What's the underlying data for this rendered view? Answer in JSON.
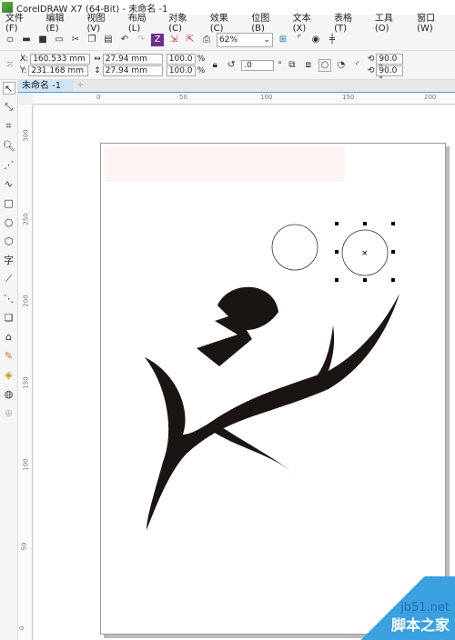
{
  "window": {
    "title": "CorelDRAW X7 (64-Bit) - 未命名 -1"
  },
  "menu": [
    "文件(F)",
    "编辑(E)",
    "视图(V)",
    "布局(L)",
    "对象(C)",
    "效果(C)",
    "位图(B)",
    "文本(X)",
    "表格(T)",
    "工具(O)",
    "窗口(W)"
  ],
  "toolbar": {
    "zoom": "62%"
  },
  "props": {
    "x": "160.533 mm",
    "y": "231.168 mm",
    "x_label": "X:",
    "y_label": "Y:",
    "w": "27.94 mm",
    "h": "27.94 mm",
    "sx": "100.0",
    "sy": "100.0",
    "pct": "%",
    "angle": ".0",
    "deg": "°",
    "a1": "90.0 °",
    "a2": "90.0 °"
  },
  "tab": {
    "label": "未命名 -1",
    "add": "+"
  },
  "hruler": [
    "0",
    "50",
    "100",
    "150",
    "200"
  ],
  "vruler": [
    "300",
    "250",
    "200",
    "150",
    "100",
    "50",
    "0"
  ],
  "watermark": {
    "site": "jb51.net",
    "name": "脚本之家"
  }
}
